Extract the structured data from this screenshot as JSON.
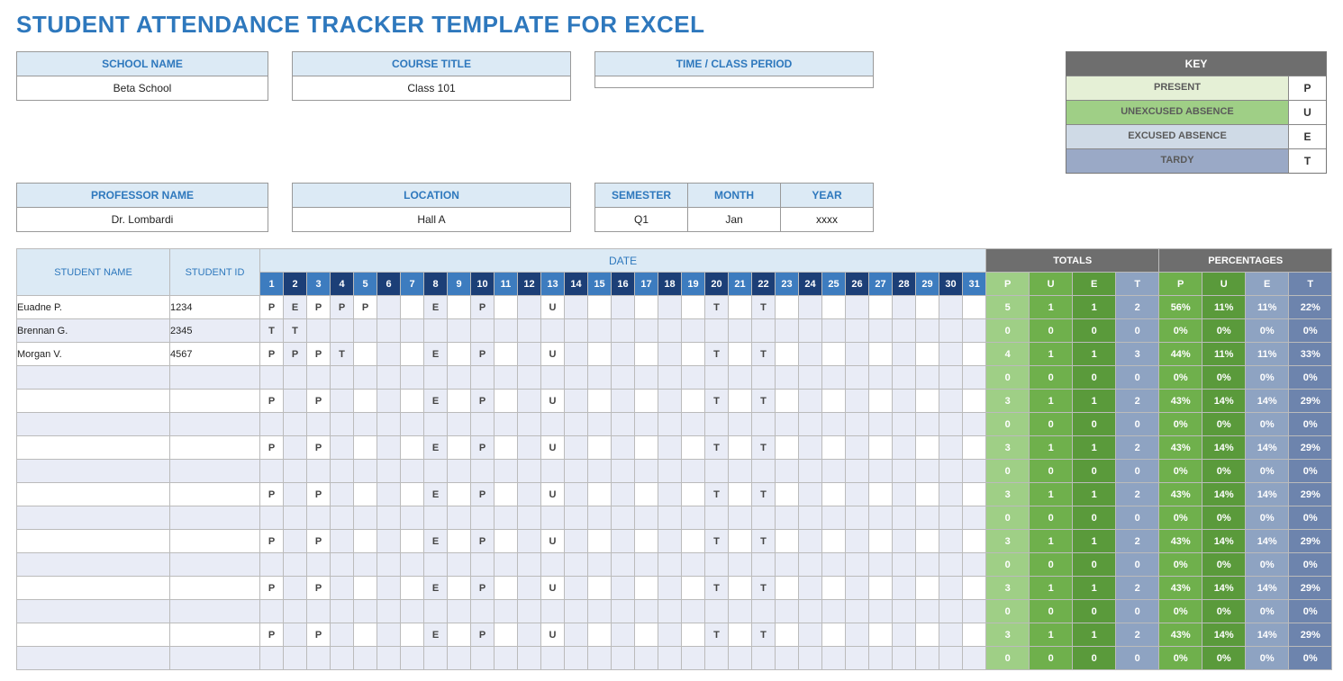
{
  "title": "STUDENT ATTENDANCE TRACKER TEMPLATE FOR EXCEL",
  "meta": {
    "school_label": "SCHOOL NAME",
    "school_value": "Beta School",
    "course_label": "COURSE TITLE",
    "course_value": "Class 101",
    "time_label": "TIME / CLASS PERIOD",
    "time_value": "",
    "prof_label": "PROFESSOR NAME",
    "prof_value": "Dr. Lombardi",
    "location_label": "LOCATION",
    "location_value": "Hall A",
    "sem_label": "SEMESTER",
    "sem_value": "Q1",
    "month_label": "MONTH",
    "month_value": "Jan",
    "year_label": "YEAR",
    "year_value": "xxxx"
  },
  "key": {
    "header": "KEY",
    "rows": [
      {
        "label": "PRESENT",
        "code": "P",
        "color": "#e5f0d6"
      },
      {
        "label": "UNEXCUSED ABSENCE",
        "code": "U",
        "color": "#9fcf86"
      },
      {
        "label": "EXCUSED ABSENCE",
        "code": "E",
        "color": "#cfdae6"
      },
      {
        "label": "TARDY",
        "code": "T",
        "color": "#9aa9c6"
      }
    ]
  },
  "table": {
    "student_name_hdr": "STUDENT NAME",
    "student_id_hdr": "STUDENT ID",
    "date_hdr": "DATE",
    "totals_hdr": "TOTALS",
    "percent_hdr": "PERCENTAGES",
    "tp_labels": [
      "P",
      "U",
      "E",
      "T"
    ],
    "tp_colors_tot": [
      "#9fcf86",
      "#6fb04c",
      "#5a9a3b",
      "#8ea3c2"
    ],
    "tp_colors_pct": [
      "#6fb04c",
      "#5a9a3b",
      "#8ea3c2",
      "#6d84ad"
    ],
    "day_colors_alt": [
      "#3d7cbf",
      "#1c3f77"
    ],
    "days": [
      "1",
      "2",
      "3",
      "4",
      "5",
      "6",
      "7",
      "8",
      "9",
      "10",
      "11",
      "12",
      "13",
      "14",
      "15",
      "16",
      "17",
      "18",
      "19",
      "20",
      "21",
      "22",
      "23",
      "24",
      "25",
      "26",
      "27",
      "28",
      "29",
      "30",
      "31"
    ],
    "rows": [
      {
        "name": "Euadne P.",
        "id": "1234",
        "cells": [
          "P",
          "E",
          "P",
          "P",
          "P",
          "",
          "",
          "E",
          "",
          "P",
          "",
          "",
          "U",
          "",
          "",
          "",
          "",
          "",
          "",
          "T",
          "",
          "T",
          "",
          "",
          "",
          "",
          "",
          "",
          "",
          "",
          ""
        ],
        "totals": [
          "5",
          "1",
          "1",
          "2"
        ],
        "pcts": [
          "56%",
          "11%",
          "11%",
          "22%"
        ]
      },
      {
        "name": "Brennan G.",
        "id": "2345",
        "cells": [
          "T",
          "T",
          "",
          "",
          "",
          "",
          "",
          "",
          "",
          "",
          "",
          "",
          "",
          "",
          "",
          "",
          "",
          "",
          "",
          "",
          "",
          "",
          "",
          "",
          "",
          "",
          "",
          "",
          "",
          "",
          ""
        ],
        "totals": [
          "0",
          "0",
          "0",
          "0"
        ],
        "pcts": [
          "0%",
          "0%",
          "0%",
          "0%"
        ]
      },
      {
        "name": "Morgan V.",
        "id": "4567",
        "cells": [
          "P",
          "P",
          "P",
          "T",
          "",
          "",
          "",
          "E",
          "",
          "P",
          "",
          "",
          "U",
          "",
          "",
          "",
          "",
          "",
          "",
          "T",
          "",
          "T",
          "",
          "",
          "",
          "",
          "",
          "",
          "",
          "",
          ""
        ],
        "totals": [
          "4",
          "1",
          "1",
          "3"
        ],
        "pcts": [
          "44%",
          "11%",
          "11%",
          "33%"
        ]
      },
      {
        "name": "",
        "id": "",
        "cells": [
          "",
          "",
          "",
          "",
          "",
          "",
          "",
          "",
          "",
          "",
          "",
          "",
          "",
          "",
          "",
          "",
          "",
          "",
          "",
          "",
          "",
          "",
          "",
          "",
          "",
          "",
          "",
          "",
          "",
          "",
          ""
        ],
        "totals": [
          "0",
          "0",
          "0",
          "0"
        ],
        "pcts": [
          "0%",
          "0%",
          "0%",
          "0%"
        ]
      },
      {
        "name": "",
        "id": "",
        "cells": [
          "P",
          "",
          "P",
          "",
          "",
          "",
          "",
          "E",
          "",
          "P",
          "",
          "",
          "U",
          "",
          "",
          "",
          "",
          "",
          "",
          "T",
          "",
          "T",
          "",
          "",
          "",
          "",
          "",
          "",
          "",
          "",
          ""
        ],
        "totals": [
          "3",
          "1",
          "1",
          "2"
        ],
        "pcts": [
          "43%",
          "14%",
          "14%",
          "29%"
        ]
      },
      {
        "name": "",
        "id": "",
        "cells": [
          "",
          "",
          "",
          "",
          "",
          "",
          "",
          "",
          "",
          "",
          "",
          "",
          "",
          "",
          "",
          "",
          "",
          "",
          "",
          "",
          "",
          "",
          "",
          "",
          "",
          "",
          "",
          "",
          "",
          "",
          ""
        ],
        "totals": [
          "0",
          "0",
          "0",
          "0"
        ],
        "pcts": [
          "0%",
          "0%",
          "0%",
          "0%"
        ]
      },
      {
        "name": "",
        "id": "",
        "cells": [
          "P",
          "",
          "P",
          "",
          "",
          "",
          "",
          "E",
          "",
          "P",
          "",
          "",
          "U",
          "",
          "",
          "",
          "",
          "",
          "",
          "T",
          "",
          "T",
          "",
          "",
          "",
          "",
          "",
          "",
          "",
          "",
          ""
        ],
        "totals": [
          "3",
          "1",
          "1",
          "2"
        ],
        "pcts": [
          "43%",
          "14%",
          "14%",
          "29%"
        ]
      },
      {
        "name": "",
        "id": "",
        "cells": [
          "",
          "",
          "",
          "",
          "",
          "",
          "",
          "",
          "",
          "",
          "",
          "",
          "",
          "",
          "",
          "",
          "",
          "",
          "",
          "",
          "",
          "",
          "",
          "",
          "",
          "",
          "",
          "",
          "",
          "",
          ""
        ],
        "totals": [
          "0",
          "0",
          "0",
          "0"
        ],
        "pcts": [
          "0%",
          "0%",
          "0%",
          "0%"
        ]
      },
      {
        "name": "",
        "id": "",
        "cells": [
          "P",
          "",
          "P",
          "",
          "",
          "",
          "",
          "E",
          "",
          "P",
          "",
          "",
          "U",
          "",
          "",
          "",
          "",
          "",
          "",
          "T",
          "",
          "T",
          "",
          "",
          "",
          "",
          "",
          "",
          "",
          "",
          ""
        ],
        "totals": [
          "3",
          "1",
          "1",
          "2"
        ],
        "pcts": [
          "43%",
          "14%",
          "14%",
          "29%"
        ]
      },
      {
        "name": "",
        "id": "",
        "cells": [
          "",
          "",
          "",
          "",
          "",
          "",
          "",
          "",
          "",
          "",
          "",
          "",
          "",
          "",
          "",
          "",
          "",
          "",
          "",
          "",
          "",
          "",
          "",
          "",
          "",
          "",
          "",
          "",
          "",
          "",
          ""
        ],
        "totals": [
          "0",
          "0",
          "0",
          "0"
        ],
        "pcts": [
          "0%",
          "0%",
          "0%",
          "0%"
        ]
      },
      {
        "name": "",
        "id": "",
        "cells": [
          "P",
          "",
          "P",
          "",
          "",
          "",
          "",
          "E",
          "",
          "P",
          "",
          "",
          "U",
          "",
          "",
          "",
          "",
          "",
          "",
          "T",
          "",
          "T",
          "",
          "",
          "",
          "",
          "",
          "",
          "",
          "",
          ""
        ],
        "totals": [
          "3",
          "1",
          "1",
          "2"
        ],
        "pcts": [
          "43%",
          "14%",
          "14%",
          "29%"
        ]
      },
      {
        "name": "",
        "id": "",
        "cells": [
          "",
          "",
          "",
          "",
          "",
          "",
          "",
          "",
          "",
          "",
          "",
          "",
          "",
          "",
          "",
          "",
          "",
          "",
          "",
          "",
          "",
          "",
          "",
          "",
          "",
          "",
          "",
          "",
          "",
          "",
          ""
        ],
        "totals": [
          "0",
          "0",
          "0",
          "0"
        ],
        "pcts": [
          "0%",
          "0%",
          "0%",
          "0%"
        ]
      },
      {
        "name": "",
        "id": "",
        "cells": [
          "P",
          "",
          "P",
          "",
          "",
          "",
          "",
          "E",
          "",
          "P",
          "",
          "",
          "U",
          "",
          "",
          "",
          "",
          "",
          "",
          "T",
          "",
          "T",
          "",
          "",
          "",
          "",
          "",
          "",
          "",
          "",
          ""
        ],
        "totals": [
          "3",
          "1",
          "1",
          "2"
        ],
        "pcts": [
          "43%",
          "14%",
          "14%",
          "29%"
        ]
      },
      {
        "name": "",
        "id": "",
        "cells": [
          "",
          "",
          "",
          "",
          "",
          "",
          "",
          "",
          "",
          "",
          "",
          "",
          "",
          "",
          "",
          "",
          "",
          "",
          "",
          "",
          "",
          "",
          "",
          "",
          "",
          "",
          "",
          "",
          "",
          "",
          ""
        ],
        "totals": [
          "0",
          "0",
          "0",
          "0"
        ],
        "pcts": [
          "0%",
          "0%",
          "0%",
          "0%"
        ]
      },
      {
        "name": "",
        "id": "",
        "cells": [
          "P",
          "",
          "P",
          "",
          "",
          "",
          "",
          "E",
          "",
          "P",
          "",
          "",
          "U",
          "",
          "",
          "",
          "",
          "",
          "",
          "T",
          "",
          "T",
          "",
          "",
          "",
          "",
          "",
          "",
          "",
          "",
          ""
        ],
        "totals": [
          "3",
          "1",
          "1",
          "2"
        ],
        "pcts": [
          "43%",
          "14%",
          "14%",
          "29%"
        ]
      },
      {
        "name": "",
        "id": "",
        "cells": [
          "",
          "",
          "",
          "",
          "",
          "",
          "",
          "",
          "",
          "",
          "",
          "",
          "",
          "",
          "",
          "",
          "",
          "",
          "",
          "",
          "",
          "",
          "",
          "",
          "",
          "",
          "",
          "",
          "",
          "",
          ""
        ],
        "totals": [
          "0",
          "0",
          "0",
          "0"
        ],
        "pcts": [
          "0%",
          "0%",
          "0%",
          "0%"
        ]
      }
    ]
  }
}
